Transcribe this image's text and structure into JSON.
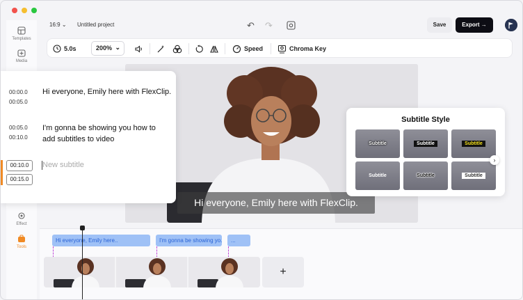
{
  "sidebar": {
    "items": [
      {
        "label": "Templates",
        "icon": "templates-icon"
      },
      {
        "label": "Media",
        "icon": "media-icon"
      },
      {
        "label": "Effect",
        "icon": "effect-icon"
      },
      {
        "label": "Tools",
        "icon": "tools-icon"
      }
    ]
  },
  "topbar": {
    "ratio": "16:9",
    "project_title": "Untitled project",
    "save_label": "Save",
    "export_label": "Export"
  },
  "toolbar": {
    "duration": "5.0s",
    "zoom": "200%",
    "speed_label": "Speed",
    "chroma_label": "Chroma Key"
  },
  "canvas": {
    "caption": "Hi everyone, Emily here with FlexClip."
  },
  "subtitles": {
    "entries": [
      {
        "start": "00:00.0",
        "end": "00:05.0",
        "text": "Hi everyone, Emily here with FlexClip."
      },
      {
        "start": "00:05.0",
        "end": "00:10.0",
        "text": "I'm gonna be showing you how to add subtitles to video"
      }
    ],
    "new_entry": {
      "start": "00:10.0",
      "end": "00:15.0",
      "placeholder": "New subtitle"
    }
  },
  "subtitle_style": {
    "title": "Subtitle Style",
    "tiles": [
      "Subtitle",
      "Subtitle",
      "Subtitle",
      "Subtitle",
      "Subtitle",
      "Subtitle"
    ]
  },
  "timeline": {
    "chips": [
      "Hi everyone, Emily here..",
      "I'm gonna be showing yo..",
      "..."
    ],
    "add_label": "+"
  },
  "colors": {
    "accent_orange": "#f08a24",
    "chip_blue": "#9fc1f6",
    "export_bg": "#0d0d14"
  }
}
